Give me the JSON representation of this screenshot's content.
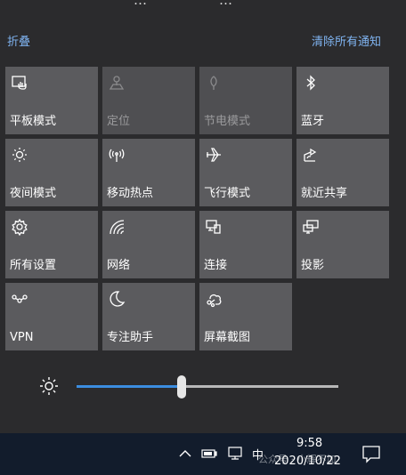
{
  "header": {
    "cut_text_1": "…",
    "cut_text_2": "…",
    "collapse_label": "折叠",
    "clear_all_label": "清除所有通知"
  },
  "tiles": [
    {
      "label": "平板模式",
      "icon": "tablet-mode-icon",
      "active": true
    },
    {
      "label": "定位",
      "icon": "location-icon",
      "active": false
    },
    {
      "label": "节电模式",
      "icon": "battery-saver-icon",
      "active": false
    },
    {
      "label": "蓝牙",
      "icon": "bluetooth-icon",
      "active": true
    },
    {
      "label": "夜间模式",
      "icon": "night-light-icon",
      "active": true
    },
    {
      "label": "移动热点",
      "icon": "mobile-hotspot-icon",
      "active": true
    },
    {
      "label": "飞行模式",
      "icon": "airplane-icon",
      "active": true
    },
    {
      "label": "就近共享",
      "icon": "nearby-share-icon",
      "active": true
    },
    {
      "label": "所有设置",
      "icon": "gear-icon",
      "active": true
    },
    {
      "label": "网络",
      "icon": "network-icon",
      "active": true
    },
    {
      "label": "连接",
      "icon": "connect-icon",
      "active": true
    },
    {
      "label": "投影",
      "icon": "project-icon",
      "active": true
    },
    {
      "label": "VPN",
      "icon": "vpn-icon",
      "active": true
    },
    {
      "label": "专注助手",
      "icon": "moon-icon",
      "active": true
    },
    {
      "label": "屏幕截图",
      "icon": "screen-snip-icon",
      "active": true
    }
  ],
  "brightness": {
    "icon": "sun-icon",
    "level": 0.4,
    "accent_color": "#3b8de0"
  },
  "taskbar": {
    "time": "9:58",
    "date": "2020/10/22",
    "ime_label": "中",
    "watermark": "公众号 · 小辉不加"
  }
}
